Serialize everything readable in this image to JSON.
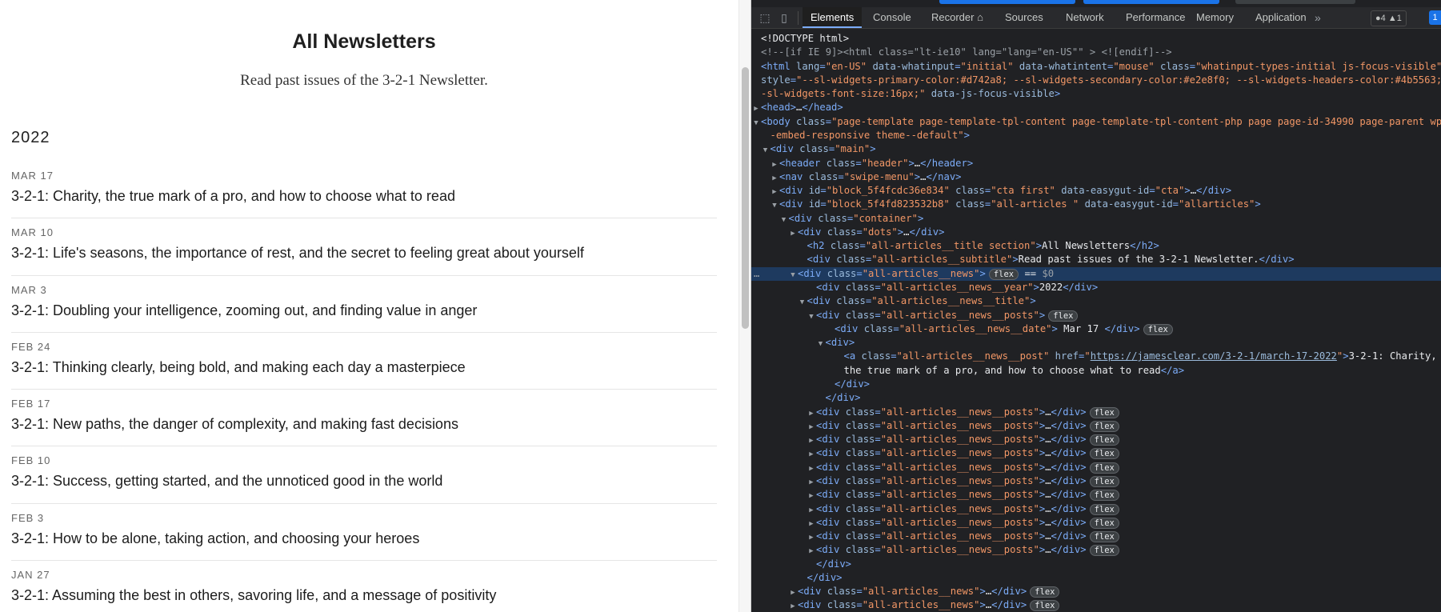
{
  "page": {
    "title": "All Newsletters",
    "subtitle": "Read past issues of the 3-2-1 Newsletter.",
    "year": "2022",
    "posts": [
      {
        "date": "MAR 17",
        "title": "3-2-1: Charity, the true mark of a pro, and how to choose what to read"
      },
      {
        "date": "MAR 10",
        "title": "3-2-1: Life's seasons, the importance of rest, and the secret to feeling great about yourself"
      },
      {
        "date": "MAR 3",
        "title": "3-2-1: Doubling your intelligence, zooming out, and finding value in anger"
      },
      {
        "date": "FEB 24",
        "title": "3-2-1: Thinking clearly, being bold, and making each day a masterpiece"
      },
      {
        "date": "FEB 17",
        "title": "3-2-1: New paths, the danger of complexity, and making fast decisions"
      },
      {
        "date": "FEB 10",
        "title": "3-2-1: Success, getting started, and the unnoticed good in the world"
      },
      {
        "date": "FEB 3",
        "title": "3-2-1: How to be alone, taking action, and choosing your heroes"
      },
      {
        "date": "JAN 27",
        "title": "3-2-1: Assuming the best in others, savoring life, and a message of positivity"
      }
    ]
  },
  "devtools": {
    "tabs": [
      "Elements",
      "Console",
      "Recorder ⌂",
      "Sources",
      "Network",
      "Performance",
      "Memory",
      "Application"
    ],
    "active_tab": "Elements",
    "more": "»",
    "badges": "●4 ▲1",
    "msg_badge": "1",
    "flex_badge": "flex",
    "dom_lines": [
      {
        "i": 0,
        "h": "<span class='tx'>&lt;!DOCTYPE html&gt;</span>"
      },
      {
        "i": 0,
        "h": "<span class='cm'>&lt;!--[if IE 9]&gt;&lt;html class=\"lt-ie10\" lang=\"lang=\"en-US\"\" &gt; &lt;![endif]--&gt;</span>"
      },
      {
        "i": 0,
        "h": "<span class='tg'>&lt;html </span><span class='an'>lang</span><span class='tg'>=</span><span class='av'>\"en-US\"</span> <span class='an'>data-whatinput</span><span class='tg'>=</span><span class='av'>\"initial\"</span> <span class='an'>data-whatintent</span><span class='tg'>=</span><span class='av'>\"mouse\"</span> <span class='an'>class</span><span class='tg'>=</span><span class='av'>\"whatinput-types-initial js-focus-visible\"</span>"
      },
      {
        "i": 0,
        "h": "<span class='an'>style</span><span class='tg'>=</span><span class='av'>\"--sl-widgets-primary-color:#d742a8; --sl-widgets-secondary-color:#e2e8f0; --sl-widgets-headers-color:#4b5563; -</span>"
      },
      {
        "i": 0,
        "h": "<span class='av'>-sl-widgets-font-size:16px;\"</span> <span class='an'>data-js-focus-visible</span><span class='tg'>&gt;</span>"
      },
      {
        "i": 0,
        "t": "▶",
        "h": "<span class='tg'>&lt;head&gt;</span><span class='tx'>…</span><span class='tg'>&lt;/head&gt;</span>"
      },
      {
        "i": 0,
        "t": "▼",
        "h": "<span class='tg'>&lt;body </span><span class='an'>class</span><span class='tg'>=</span><span class='av'>\"page-template page-template-tpl-content page-template-tpl-content-php page page-id-34990 page-parent wp</span>"
      },
      {
        "i": 1,
        "h": "<span class='av'>-embed-responsive theme--default\"</span><span class='tg'>&gt;</span>"
      },
      {
        "i": 1,
        "t": "▼",
        "h": "<span class='tg'>&lt;div </span><span class='an'>class</span><span class='tg'>=</span><span class='av'>\"main\"</span><span class='tg'>&gt;</span>"
      },
      {
        "i": 2,
        "t": "▶",
        "h": "<span class='tg'>&lt;header </span><span class='an'>class</span><span class='tg'>=</span><span class='av'>\"header\"</span><span class='tg'>&gt;</span><span class='tx'>…</span><span class='tg'>&lt;/header&gt;</span>"
      },
      {
        "i": 2,
        "t": "▶",
        "h": "<span class='tg'>&lt;nav </span><span class='an'>class</span><span class='tg'>=</span><span class='av'>\"swipe-menu\"</span><span class='tg'>&gt;</span><span class='tx'>…</span><span class='tg'>&lt;/nav&gt;</span>"
      },
      {
        "i": 2,
        "t": "▶",
        "h": "<span class='tg'>&lt;div </span><span class='an'>id</span><span class='tg'>=</span><span class='av'>\"block_5f4fcdc36e834\"</span> <span class='an'>class</span><span class='tg'>=</span><span class='av'>\"cta first\"</span> <span class='an'>data-easygut-id</span><span class='tg'>=</span><span class='av'>\"cta\"</span><span class='tg'>&gt;</span><span class='tx'>…</span><span class='tg'>&lt;/div&gt;</span>"
      },
      {
        "i": 2,
        "t": "▼",
        "h": "<span class='tg'>&lt;div </span><span class='an'>id</span><span class='tg'>=</span><span class='av'>\"block_5f4fd823532b8\"</span> <span class='an'>class</span><span class='tg'>=</span><span class='av'>\"all-articles \"</span> <span class='an'>data-easygut-id</span><span class='tg'>=</span><span class='av'>\"allarticles\"</span><span class='tg'>&gt;</span>"
      },
      {
        "i": 3,
        "t": "▼",
        "h": "<span class='tg'>&lt;div </span><span class='an'>class</span><span class='tg'>=</span><span class='av'>\"container\"</span><span class='tg'>&gt;</span>"
      },
      {
        "i": 4,
        "t": "▶",
        "h": "<span class='tg'>&lt;div </span><span class='an'>class</span><span class='tg'>=</span><span class='av'>\"dots\"</span><span class='tg'>&gt;</span><span class='tx'>…</span><span class='tg'>&lt;/div&gt;</span>"
      },
      {
        "i": 5,
        "h": "<span class='tg'>&lt;h2 </span><span class='an'>class</span><span class='tg'>=</span><span class='av'>\"all-articles__title section\"</span><span class='tg'>&gt;</span><span class='tx'>All Newsletters</span><span class='tg'>&lt;/h2&gt;</span>"
      },
      {
        "i": 5,
        "h": "<span class='tg'>&lt;div </span><span class='an'>class</span><span class='tg'>=</span><span class='av'>\"all-articles__subtitle\"</span><span class='tg'>&gt;</span><span class='tx'>Read past issues of the 3-2-1 Newsletter.</span><span class='tg'>&lt;/div&gt;</span>"
      },
      {
        "i": 4,
        "t": "▼",
        "sel": true,
        "h": "<span class='tg'>&lt;div </span><span class='an'>class</span><span class='tg'>=</span><span class='av'>\"all-articles__news\"</span><span class='tg'>&gt;</span><span class='fx'>flex</span> <span class='tx'>== </span><span class='cm'>$0</span>"
      },
      {
        "i": 6,
        "h": "<span class='tg'>&lt;div </span><span class='an'>class</span><span class='tg'>=</span><span class='av'>\"all-articles__news__year\"</span><span class='tg'>&gt;</span><span class='tx'>2022</span><span class='tg'>&lt;/div&gt;</span>"
      },
      {
        "i": 5,
        "t": "▼",
        "h": "<span class='tg'>&lt;div </span><span class='an'>class</span><span class='tg'>=</span><span class='av'>\"all-articles__news__title\"</span><span class='tg'>&gt;</span>"
      },
      {
        "i": 6,
        "t": "▼",
        "h": "<span class='tg'>&lt;div </span><span class='an'>class</span><span class='tg'>=</span><span class='av'>\"all-articles__news__posts\"</span><span class='tg'>&gt;</span><span class='fx'>flex</span>"
      },
      {
        "i": 8,
        "h": "<span class='tg'>&lt;div </span><span class='an'>class</span><span class='tg'>=</span><span class='av'>\"all-articles__news__date\"</span><span class='tg'>&gt;</span><span class='tx'> Mar 17 </span><span class='tg'>&lt;/div&gt;</span><span class='fx'>flex</span>"
      },
      {
        "i": 7,
        "t": "▼",
        "h": "<span class='tg'>&lt;div&gt;</span>"
      },
      {
        "i": 9,
        "h": "<span class='tg'>&lt;a </span><span class='an'>class</span><span class='tg'>=</span><span class='av'>\"all-articles__news__post\"</span> <span class='an'>href</span><span class='tg'>=</span><span class='av'>\"</span><span class='lk'>https://jamesclear.com/3-2-1/march-17-2022</span><span class='av'>\"</span><span class='tg'>&gt;</span><span class='tx'>3-2-1: Charity,</span>"
      },
      {
        "i": 9,
        "h": "<span class='tx'>the true mark of a pro, and how to choose what to read</span><span class='tg'>&lt;/a&gt;</span>"
      },
      {
        "i": 8,
        "h": "<span class='tg'>&lt;/div&gt;</span>"
      },
      {
        "i": 7,
        "h": "<span class='tg'>&lt;/div&gt;</span>"
      },
      {
        "i": 6,
        "t": "▶",
        "h": "<span class='tg'>&lt;div </span><span class='an'>class</span><span class='tg'>=</span><span class='av'>\"all-articles__news__posts\"</span><span class='tg'>&gt;</span><span class='tx'>…</span><span class='tg'>&lt;/div&gt;</span><span class='fx'>flex</span>"
      },
      {
        "i": 6,
        "t": "▶",
        "h": "<span class='tg'>&lt;div </span><span class='an'>class</span><span class='tg'>=</span><span class='av'>\"all-articles__news__posts\"</span><span class='tg'>&gt;</span><span class='tx'>…</span><span class='tg'>&lt;/div&gt;</span><span class='fx'>flex</span>"
      },
      {
        "i": 6,
        "t": "▶",
        "h": "<span class='tg'>&lt;div </span><span class='an'>class</span><span class='tg'>=</span><span class='av'>\"all-articles__news__posts\"</span><span class='tg'>&gt;</span><span class='tx'>…</span><span class='tg'>&lt;/div&gt;</span><span class='fx'>flex</span>"
      },
      {
        "i": 6,
        "t": "▶",
        "h": "<span class='tg'>&lt;div </span><span class='an'>class</span><span class='tg'>=</span><span class='av'>\"all-articles__news__posts\"</span><span class='tg'>&gt;</span><span class='tx'>…</span><span class='tg'>&lt;/div&gt;</span><span class='fx'>flex</span>"
      },
      {
        "i": 6,
        "t": "▶",
        "h": "<span class='tg'>&lt;div </span><span class='an'>class</span><span class='tg'>=</span><span class='av'>\"all-articles__news__posts\"</span><span class='tg'>&gt;</span><span class='tx'>…</span><span class='tg'>&lt;/div&gt;</span><span class='fx'>flex</span>"
      },
      {
        "i": 6,
        "t": "▶",
        "h": "<span class='tg'>&lt;div </span><span class='an'>class</span><span class='tg'>=</span><span class='av'>\"all-articles__news__posts\"</span><span class='tg'>&gt;</span><span class='tx'>…</span><span class='tg'>&lt;/div&gt;</span><span class='fx'>flex</span>"
      },
      {
        "i": 6,
        "t": "▶",
        "h": "<span class='tg'>&lt;div </span><span class='an'>class</span><span class='tg'>=</span><span class='av'>\"all-articles__news__posts\"</span><span class='tg'>&gt;</span><span class='tx'>…</span><span class='tg'>&lt;/div&gt;</span><span class='fx'>flex</span>"
      },
      {
        "i": 6,
        "t": "▶",
        "h": "<span class='tg'>&lt;div </span><span class='an'>class</span><span class='tg'>=</span><span class='av'>\"all-articles__news__posts\"</span><span class='tg'>&gt;</span><span class='tx'>…</span><span class='tg'>&lt;/div&gt;</span><span class='fx'>flex</span>"
      },
      {
        "i": 6,
        "t": "▶",
        "h": "<span class='tg'>&lt;div </span><span class='an'>class</span><span class='tg'>=</span><span class='av'>\"all-articles__news__posts\"</span><span class='tg'>&gt;</span><span class='tx'>…</span><span class='tg'>&lt;/div&gt;</span><span class='fx'>flex</span>"
      },
      {
        "i": 6,
        "t": "▶",
        "h": "<span class='tg'>&lt;div </span><span class='an'>class</span><span class='tg'>=</span><span class='av'>\"all-articles__news__posts\"</span><span class='tg'>&gt;</span><span class='tx'>…</span><span class='tg'>&lt;/div&gt;</span><span class='fx'>flex</span>"
      },
      {
        "i": 6,
        "t": "▶",
        "h": "<span class='tg'>&lt;div </span><span class='an'>class</span><span class='tg'>=</span><span class='av'>\"all-articles__news__posts\"</span><span class='tg'>&gt;</span><span class='tx'>…</span><span class='tg'>&lt;/div&gt;</span><span class='fx'>flex</span>"
      },
      {
        "i": 6,
        "h": "<span class='tg'>&lt;/div&gt;</span>"
      },
      {
        "i": 5,
        "h": "<span class='tg'>&lt;/div&gt;</span>"
      },
      {
        "i": 4,
        "t": "▶",
        "h": "<span class='tg'>&lt;div </span><span class='an'>class</span><span class='tg'>=</span><span class='av'>\"all-articles__news\"</span><span class='tg'>&gt;</span><span class='tx'>…</span><span class='tg'>&lt;/div&gt;</span><span class='fx'>flex</span>"
      },
      {
        "i": 4,
        "t": "▶",
        "h": "<span class='tg'>&lt;div </span><span class='an'>class</span><span class='tg'>=</span><span class='av'>\"all-articles__news\"</span><span class='tg'>&gt;</span><span class='tx'>…</span><span class='tg'>&lt;/div&gt;</span><span class='fx'>flex</span>"
      },
      {
        "i": 4,
        "t": "▶",
        "h": "<span class='tg'>&lt;div </span><span class='an'>class</span><span class='tg'>=</span><span class='av'>\"all-articles__news\"</span><span class='tg'>&gt;</span><span class='tx'>…</span><span class='tg'>&lt;/div&gt;</span><span class='fx'>flex</span>"
      }
    ]
  }
}
